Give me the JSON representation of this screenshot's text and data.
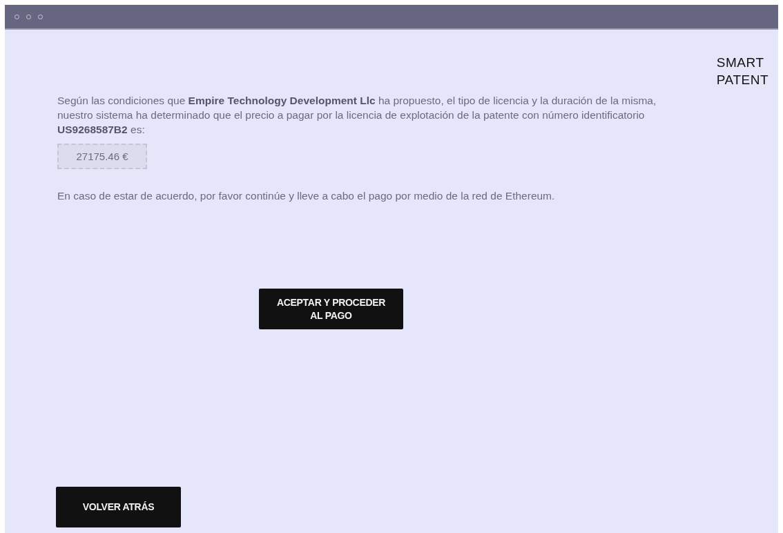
{
  "logo": [
    "SMART",
    "PATENT"
  ],
  "intro": "Según las condiciones que **Empire Technology Development Llc**  ha propuesto, el tipo de licencia y la duración de la misma, nuestro sistema ha determinado  que el precio a pagar por la licencia de explotación de la patente con número identificatorio **US9268587B2** es:",
  "price": "27175.46 €",
  "note": "En caso de estar de acuerdo, por favor continúe y lleve a cabo el pago por medio de la red de Ethereum.",
  "accept_button": [
    "ACEPTAR Y PROCEDER",
    "AL PAGO"
  ],
  "back_button": "VOLVER ATRÁS"
}
